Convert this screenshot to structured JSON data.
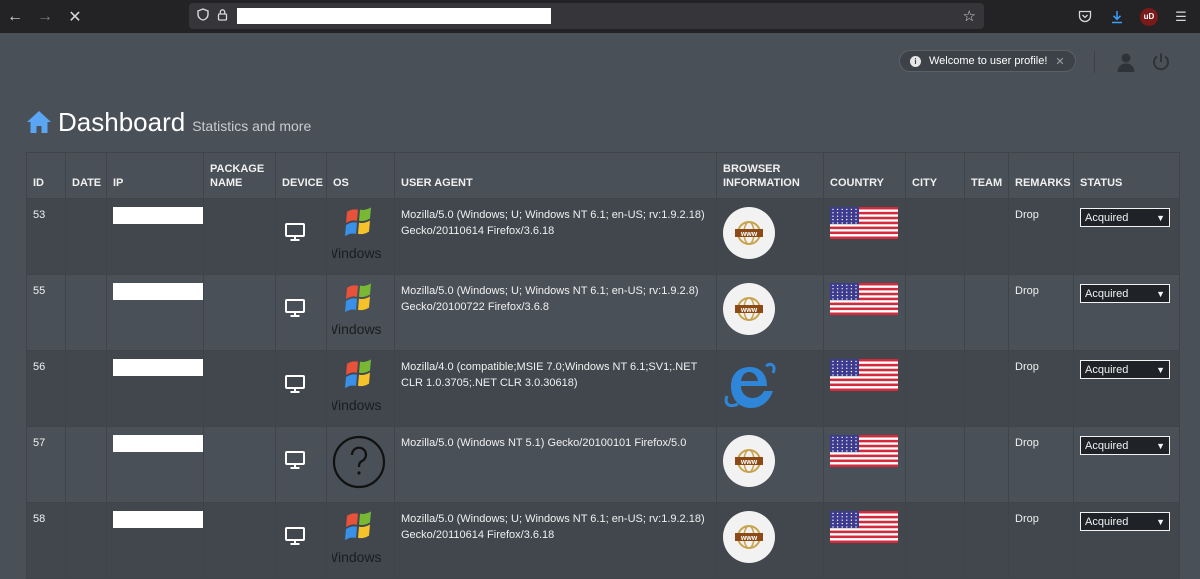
{
  "page": {
    "welcome": "Welcome to user profile!",
    "title": "Dashboard",
    "subtitle": "Statistics and more"
  },
  "table": {
    "headers": [
      "ID",
      "DATE",
      "IP",
      "PACKAGE NAME",
      "DEVICE",
      "OS",
      "USER AGENT",
      "BROWSER INFORMATION",
      "COUNTRY",
      "CITY",
      "TEAM",
      "REMARKS",
      "STATUS"
    ],
    "rows": [
      {
        "id": "53",
        "os": "windows7",
        "agent": "Mozilla/5.0 (Windows; U; Windows NT 6.1; en-US; rv:1.9.2.18) Gecko/20110614 Firefox/3.6.18",
        "browser": "www",
        "remarks": "Drop",
        "status": "Acquired"
      },
      {
        "id": "55",
        "os": "windows7",
        "agent": "Mozilla/5.0 (Windows; U; Windows NT 6.1; en-US; rv:1.9.2.8) Gecko/20100722 Firefox/3.6.8",
        "browser": "www",
        "remarks": "Drop",
        "status": "Acquired"
      },
      {
        "id": "56",
        "os": "windows7",
        "agent": "Mozilla/4.0 (compatible;MSIE 7.0;Windows NT 6.1;SV1;.NET CLR 1.0.3705;.NET CLR 3.0.30618)",
        "browser": "ie",
        "remarks": "Drop",
        "status": "Acquired"
      },
      {
        "id": "57",
        "os": "unknown",
        "agent": "Mozilla/5.0 (Windows NT 5.1) Gecko/20100101 Firefox/5.0",
        "browser": "www",
        "remarks": "Drop",
        "status": "Acquired"
      },
      {
        "id": "58",
        "os": "windows7",
        "agent": "Mozilla/5.0 (Windows; U; Windows NT 6.1; en-US; rv:1.9.2.18) Gecko/20110614 Firefox/3.6.18",
        "browser": "www",
        "remarks": "Drop",
        "status": "Acquired"
      }
    ]
  },
  "os_labels": {
    "windows7": "Windows 7"
  },
  "icons": [
    "back-icon",
    "forward-icon",
    "stop-icon",
    "shield-icon",
    "lock-icon",
    "star-icon",
    "pocket-icon",
    "download-icon",
    "ublock-icon",
    "menu-icon",
    "info-icon",
    "close-icon",
    "user-icon",
    "power-icon",
    "home-icon",
    "monitor-icon",
    "windows7-logo-icon",
    "question-mark-icon",
    "www-globe-icon",
    "internet-explorer-icon",
    "us-flag-icon"
  ],
  "colors": {
    "accent": "#3a8ee6",
    "page_bg": "#4a5057",
    "row_alt": "#41474d"
  }
}
